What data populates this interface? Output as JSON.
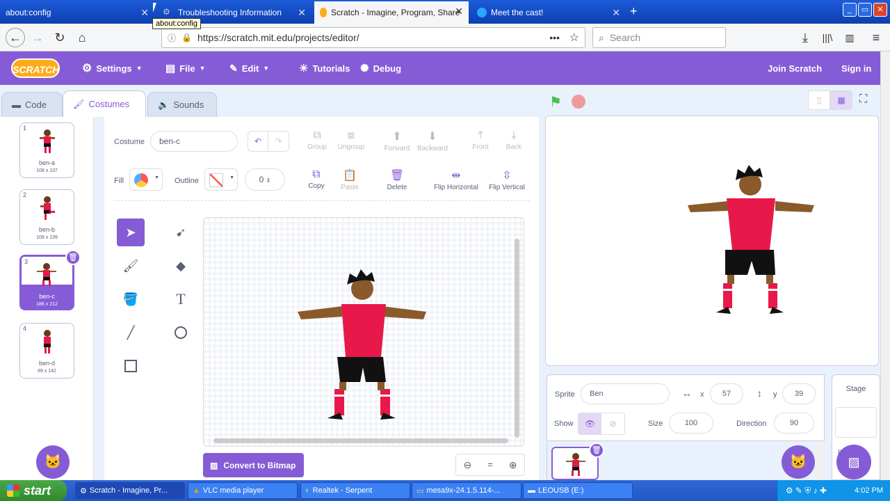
{
  "browser": {
    "tabs": [
      {
        "title": "about:config"
      },
      {
        "title": "Troubleshooting Information"
      },
      {
        "title": "Scratch - Imagine, Program, Share"
      },
      {
        "title": "Meet the cast!"
      }
    ],
    "tooltip": "about:config",
    "url": "https://scratch.mit.edu/projects/editor/",
    "search_placeholder": "Search"
  },
  "menu": {
    "logo": "SCRATCH",
    "settings": "Settings",
    "file": "File",
    "edit": "Edit",
    "tutorials": "Tutorials",
    "debug": "Debug",
    "join": "Join Scratch",
    "signin": "Sign in"
  },
  "tabs": {
    "code": "Code",
    "costumes": "Costumes",
    "sounds": "Sounds"
  },
  "costumes": [
    {
      "num": "1",
      "name": "ben-a",
      "size": "108 x 137"
    },
    {
      "num": "2",
      "name": "ben-b",
      "size": "108 x 139"
    },
    {
      "num": "3",
      "name": "ben-c",
      "size": "186 x 212"
    },
    {
      "num": "4",
      "name": "ben-d",
      "size": "89 x 142"
    }
  ],
  "paint": {
    "costume_label": "Costume",
    "costume_name": "ben-c",
    "fill_label": "Fill",
    "outline_label": "Outline",
    "outline_width": "0",
    "group": "Group",
    "ungroup": "Ungroup",
    "forward": "Forward",
    "backward": "Backward",
    "front": "Front",
    "back": "Back",
    "copy": "Copy",
    "paste": "Paste",
    "delete": "Delete",
    "flip_h": "Flip Horizontal",
    "flip_v": "Flip Vertical",
    "convert": "Convert to Bitmap",
    "zoom_reset": "="
  },
  "sprite": {
    "sprite_label": "Sprite",
    "name": "Ben",
    "x_label": "x",
    "x": "57",
    "y_label": "y",
    "y": "39",
    "show_label": "Show",
    "size_label": "Size",
    "size": "100",
    "direction_label": "Direction",
    "direction": "90",
    "stage_label": "Stage",
    "backdrops_partial": "B"
  },
  "taskbar": {
    "start": "start",
    "items": [
      {
        "label": "Scratch - Imagine, Pr..."
      },
      {
        "label": "VLC media player"
      },
      {
        "label": "Realtek - Serpent"
      },
      {
        "label": "mesa9x-24.1.5.114-..."
      },
      {
        "label": "LEOUSB (E:)"
      }
    ],
    "clock": "4:02 PM"
  },
  "colors": {
    "accent": "#855cd6",
    "menu": "#855cd6",
    "logo": "#ffab19",
    "shirt": "#e8184a"
  }
}
